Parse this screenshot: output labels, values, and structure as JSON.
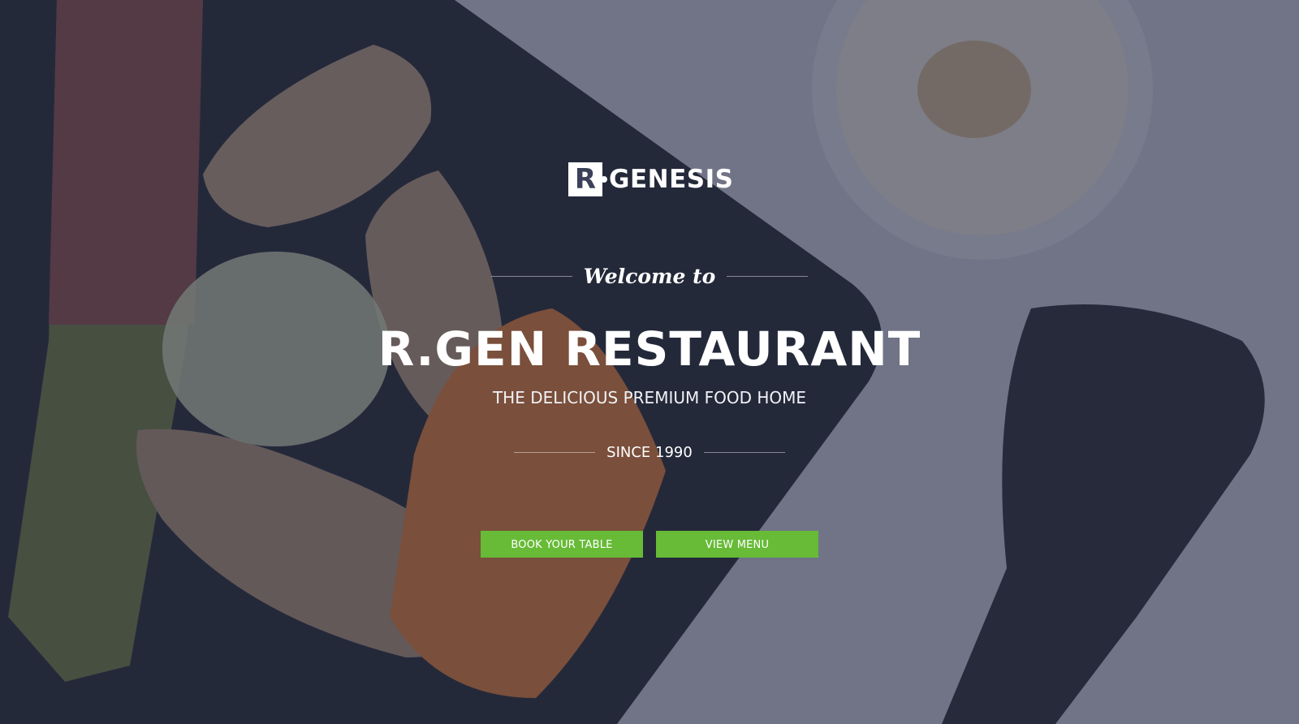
{
  "brand": {
    "logo_letter": "R",
    "logo_text": "GENESIS"
  },
  "hero": {
    "welcome": "Welcome to",
    "title": "R.GEN RESTAURANT",
    "subtitle": "THE DELICIOUS PREMIUM FOOD HOME",
    "since": "SINCE 1990"
  },
  "actions": {
    "book_label": "BOOK YOUR TABLE",
    "menu_label": "VIEW MENU"
  },
  "colors": {
    "accent": "#67bb37",
    "overlay": "#262c46",
    "plate": "#2a2d35",
    "table": "#c8cad2"
  }
}
